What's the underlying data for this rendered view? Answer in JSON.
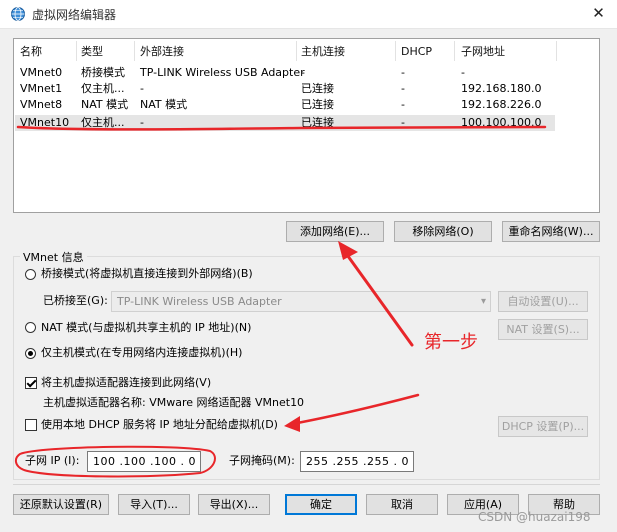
{
  "window": {
    "title": "虚拟网络编辑器",
    "close": "✕"
  },
  "table": {
    "columns": [
      "名称",
      "类型",
      "外部连接",
      "主机连接",
      "DHCP",
      "子网地址"
    ],
    "rows": [
      [
        "VMnet0",
        "桥接模式",
        "TP-LINK Wireless USB Adapter",
        "-",
        "-",
        "-"
      ],
      [
        "VMnet1",
        "仅主机...",
        "-",
        "已连接",
        "-",
        "192.168.180.0"
      ],
      [
        "VMnet8",
        "NAT 模式",
        "NAT 模式",
        "已连接",
        "-",
        "192.168.226.0"
      ],
      [
        "VMnet10",
        "仅主机...",
        "-",
        "已连接",
        "-",
        "100.100.100.0"
      ]
    ],
    "selected_row": 3
  },
  "table_buttons": {
    "add": "添加网络(E)...",
    "remove": "移除网络(O)",
    "rename": "重命名网络(W)..."
  },
  "vmnet_info": {
    "legend": "VMnet 信息",
    "bridged_label": "桥接模式(将虚拟机直接连接到外部网络)(B)",
    "bridged_to_label": "已桥接至(G):",
    "bridged_to_value": "TP-LINK Wireless USB Adapter",
    "auto_settings": "自动设置(U)...",
    "nat_label": "NAT 模式(与虚拟机共享主机的 IP 地址)(N)",
    "nat_settings": "NAT 设置(S)...",
    "hostonly_label": "仅主机模式(在专用网络内连接虚拟机)(H)",
    "selected_mode": "hostonly",
    "connect_adapter_label": "将主机虚拟适配器连接到此网络(V)",
    "connect_adapter_checked": true,
    "adapter_name_label": "主机虚拟适配器名称: VMware 网络适配器 VMnet10",
    "dhcp_label": "使用本地 DHCP 服务将 IP 地址分配给虚拟机(D)",
    "dhcp_checked": false,
    "dhcp_settings": "DHCP 设置(P)...",
    "subnet_ip_label": "子网 IP (I):",
    "subnet_ip": "100 .100 .100 . 0",
    "subnet_mask_label": "子网掩码(M):",
    "subnet_mask": "255 .255 .255 . 0"
  },
  "footer_buttons": {
    "restore": "还原默认设置(R)",
    "import": "导入(T)...",
    "export": "导出(X)...",
    "ok": "确定",
    "cancel": "取消",
    "apply": "应用(A)",
    "help": "帮助"
  },
  "annotation": {
    "step_text": "第一步",
    "color": "#e8262a"
  },
  "watermark": "CSDN @huazai198",
  "colors": {
    "accent": "#0078d7",
    "annotation": "#e8262a",
    "selected_row": "#e5e5e5"
  }
}
